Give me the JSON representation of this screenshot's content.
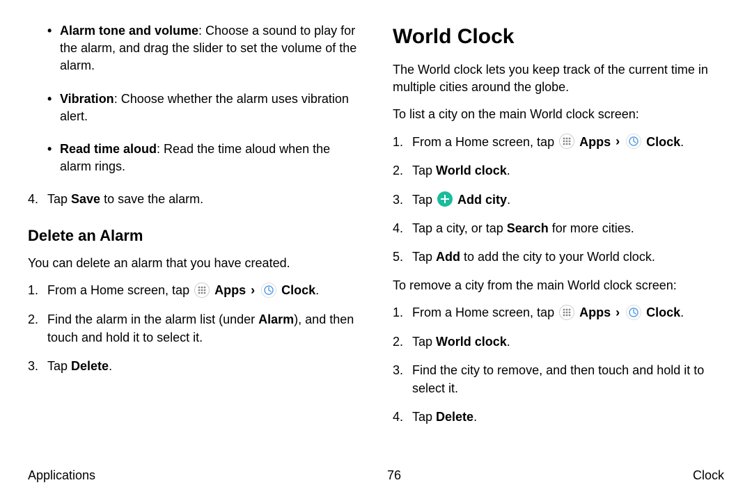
{
  "left": {
    "bullets": [
      {
        "lead": "Alarm tone and volume",
        "rest": ": Choose a sound to play for the alarm, and drag the slider to set the volume of the alarm."
      },
      {
        "lead": "Vibration",
        "rest": ": Choose whether the alarm uses vibration alert."
      },
      {
        "lead": "Read time aloud",
        "rest": ": Read the time aloud when the alarm rings."
      }
    ],
    "step4_pre": "Tap ",
    "step4_b": "Save",
    "step4_post": " to save the alarm.",
    "delete_heading": "Delete an Alarm",
    "delete_intro": "You can delete an alarm that you have created.",
    "del_s1_pre": "From a Home screen, tap ",
    "apps_label": "Apps",
    "clock_label": "Clock",
    "del_s2_pre": "Find the alarm in the alarm list (under ",
    "del_s2_b": "Alarm",
    "del_s2_post": "), and then touch and hold it to select it.",
    "del_s3_pre": "Tap ",
    "del_s3_b": "Delete",
    "del_s3_post": "."
  },
  "right": {
    "heading": "World Clock",
    "intro": "The World clock lets you keep track of the current time in multiple cities around the globe.",
    "list_intro": "To list a city on the main World clock screen:",
    "s1_pre": "From a Home screen, tap ",
    "apps_label": "Apps",
    "clock_label": "Clock",
    "s2_pre": "Tap ",
    "s2_b": "World clock",
    "s2_post": ".",
    "s3_pre": "Tap ",
    "s3_b": "Add city",
    "s3_post": ".",
    "s4_pre": "Tap a city, or tap ",
    "s4_b": "Search",
    "s4_post": " for more cities.",
    "s5_pre": "Tap ",
    "s5_b": "Add",
    "s5_post": " to add the city to your World clock.",
    "remove_intro": "To remove a city from the main World clock screen:",
    "r1_pre": "From a Home screen, tap ",
    "r2_pre": "Tap ",
    "r2_b": "World clock",
    "r2_post": ".",
    "r3": "Find the city to remove, and then touch and hold it to select it.",
    "r4_pre": "Tap ",
    "r4_b": "Delete",
    "r4_post": "."
  },
  "footer": {
    "left": "Applications",
    "center": "76",
    "right": "Clock"
  },
  "glyphs": {
    "chevron": "›"
  }
}
